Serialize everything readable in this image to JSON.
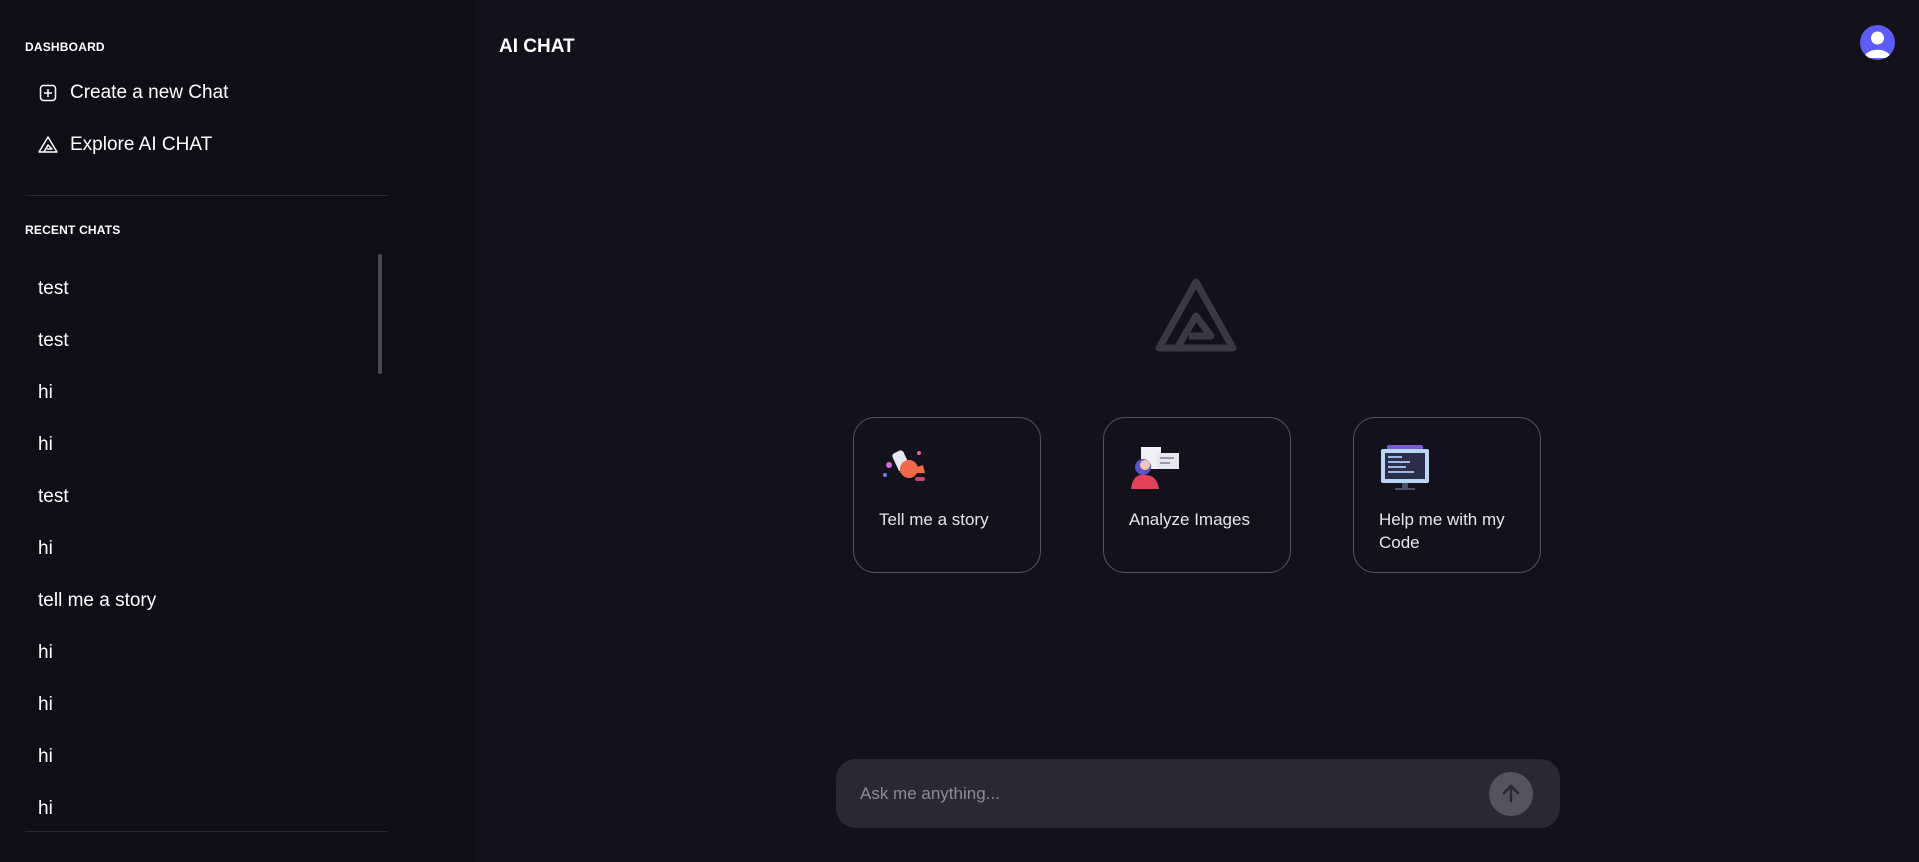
{
  "sidebar": {
    "dashboard_label": "DASHBOARD",
    "nav": [
      {
        "label": "Create a new Chat",
        "icon": "plus-square-icon"
      },
      {
        "label": "Explore AI CHAT",
        "icon": "triangle-logo-icon"
      }
    ],
    "recent_label": "RECENT CHATS",
    "recent_chats": [
      "test",
      "test",
      "hi",
      "hi",
      "test",
      "hi",
      "tell me a story",
      "hi",
      "hi",
      "hi",
      "hi"
    ]
  },
  "header": {
    "title": "AI CHAT",
    "avatar_icon": "user-avatar-icon"
  },
  "main": {
    "logo_icon": "triangle-logo-icon",
    "cards": [
      {
        "label": "Tell me a story",
        "icon": "story-illustration-icon"
      },
      {
        "label": "Analyze Images",
        "icon": "image-analysis-illustration-icon"
      },
      {
        "label": "Help me with my Code",
        "icon": "code-illustration-icon"
      }
    ]
  },
  "input": {
    "placeholder": "Ask me anything...",
    "value": "",
    "send_icon": "arrow-up-icon"
  },
  "colors": {
    "background": "#13111c",
    "sidebar": "#0f0d16",
    "input": "#2a2833",
    "avatar": "#5d5cf5",
    "card_border": "#55535e"
  }
}
